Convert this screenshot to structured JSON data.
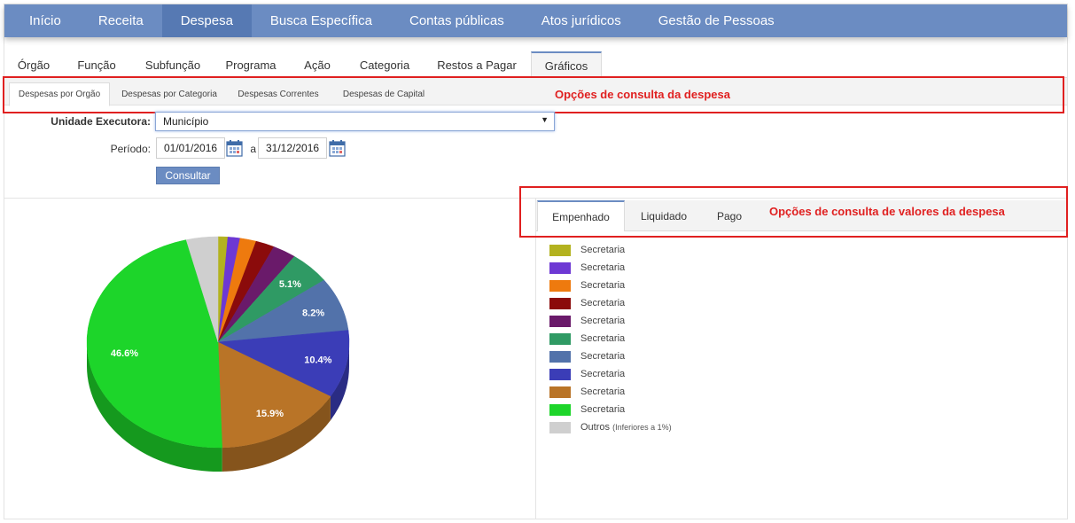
{
  "topnav": {
    "items": [
      "Início",
      "Receita",
      "Despesa",
      "Busca Específica",
      "Contas públicas",
      "Atos jurídicos",
      "Gestão de Pessoas"
    ],
    "active_index": 2
  },
  "tabs2": {
    "items": [
      "Órgão",
      "Função",
      "Subfunção",
      "Programa",
      "Ação",
      "Categoria",
      "Restos a Pagar",
      "Gráficos"
    ],
    "active_index": 7
  },
  "tabs3": {
    "items": [
      "Despesas por Orgão",
      "Despesas por Categoria",
      "Despesas Correntes",
      "Despesas de Capital"
    ],
    "active_index": 0
  },
  "annotations": {
    "consulta_despesa": "Opções de consulta da despesa",
    "consulta_valores": "Opções de consulta de valores da despesa",
    "color": "#e02020"
  },
  "form": {
    "unidade_label": "Unidade Executora:",
    "unidade_value": "Município",
    "periodo_label": "Período:",
    "date_from": "01/01/2016",
    "date_sep": "a",
    "date_to": "31/12/2016",
    "consultar_label": "Consultar"
  },
  "valtabs": {
    "items": [
      "Empenhado",
      "Liquidado",
      "Pago"
    ],
    "active_index": 0
  },
  "legend": {
    "items": [
      {
        "label": "Secretaria",
        "color": "#b3b21f"
      },
      {
        "label": "Secretaria",
        "color": "#6d38d4"
      },
      {
        "label": "Secretaria",
        "color": "#ee7a0e"
      },
      {
        "label": "Secretaria",
        "color": "#8b0b0b"
      },
      {
        "label": "Secretaria",
        "color": "#6a1a6a"
      },
      {
        "label": "Secretaria",
        "color": "#2f9a64"
      },
      {
        "label": "Secretaria",
        "color": "#5272aa"
      },
      {
        "label": "Secretaria",
        "color": "#3b3db7"
      },
      {
        "label": "Secretaria",
        "color": "#b97427"
      },
      {
        "label": "Secretaria",
        "color": "#1dd52a"
      },
      {
        "label": "Outros",
        "note": "(Inferiores a 1%)",
        "color": "#cfcfcf"
      }
    ]
  },
  "chart_data": {
    "type": "pie",
    "title": "",
    "slices": [
      {
        "label": "",
        "value": 1.2,
        "color": "#b3b21f"
      },
      {
        "label": "",
        "value": 1.5,
        "color": "#6d38d4"
      },
      {
        "label": "",
        "value": 2.0,
        "color": "#ee7a0e"
      },
      {
        "label": "",
        "value": 2.3,
        "color": "#8b0b0b"
      },
      {
        "label": "",
        "value": 2.9,
        "color": "#6a1a6a"
      },
      {
        "label": "5.1%",
        "value": 5.1,
        "color": "#2f9a64"
      },
      {
        "label": "8.2%",
        "value": 8.2,
        "color": "#5272aa"
      },
      {
        "label": "10.4%",
        "value": 10.4,
        "color": "#3b3db7"
      },
      {
        "label": "15.9%",
        "value": 15.9,
        "color": "#b97427"
      },
      {
        "label": "46.6%",
        "value": 46.6,
        "color": "#1dd52a"
      },
      {
        "label": "",
        "value": 3.9,
        "color": "#cfcfcf"
      }
    ]
  }
}
